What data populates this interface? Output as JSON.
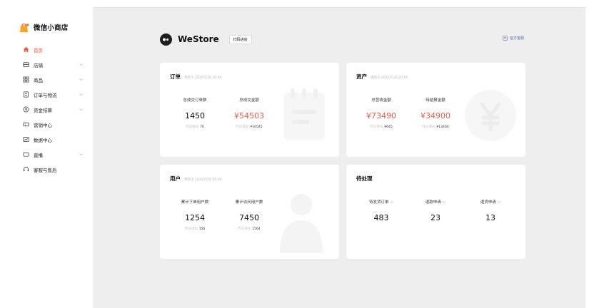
{
  "brand": {
    "name": "微信小商店"
  },
  "sidebar": {
    "items": [
      {
        "label": "首页",
        "icon": "home-icon",
        "active": true,
        "expandable": false
      },
      {
        "label": "店铺",
        "icon": "store-icon",
        "active": false,
        "expandable": true
      },
      {
        "label": "商品",
        "icon": "grid-icon",
        "active": false,
        "expandable": true
      },
      {
        "label": "订单与物流",
        "icon": "order-icon",
        "active": false,
        "expandable": true
      },
      {
        "label": "资金结算",
        "icon": "money-icon",
        "active": false,
        "expandable": true
      },
      {
        "label": "营销中心",
        "icon": "coupon-icon",
        "active": false,
        "expandable": false
      },
      {
        "label": "数据中心",
        "icon": "chart-icon",
        "active": false,
        "expandable": false
      },
      {
        "label": "直播",
        "icon": "live-icon",
        "active": false,
        "expandable": true
      },
      {
        "label": "客服与售后",
        "icon": "headset-icon",
        "active": false,
        "expandable": false
      }
    ]
  },
  "header": {
    "store_name": "WeStore",
    "scan_button": "扫码进店",
    "official_link": "官方客服"
  },
  "cards": {
    "orders": {
      "title": "订单",
      "updated": "更新于 2020/5/28 20:00",
      "stats": [
        {
          "label": "总成交订单数",
          "value": "1450",
          "sub_label": "昨日增加",
          "sub_value": "70"
        },
        {
          "label": "总成交金额",
          "value": "¥54503",
          "sub_label": "昨日增加",
          "sub_value": "¥10545"
        }
      ]
    },
    "assets": {
      "title": "资产",
      "updated": "更新于 2020/5/28 20:00",
      "stats": [
        {
          "label": "总营收金额",
          "value": "¥73490",
          "sub_label": "昨日增加",
          "sub_value": "¥645"
        },
        {
          "label": "待结算金额",
          "value": "¥34900",
          "sub_label": "昨日增加",
          "sub_value": "¥13400"
        }
      ]
    },
    "users": {
      "title": "用户",
      "updated": "更新于 2020/5/28 20:00",
      "stats": [
        {
          "label": "累计下单用户数",
          "value": "1254",
          "sub_label": "昨日增加",
          "sub_value": "156"
        },
        {
          "label": "累计访问用户数",
          "value": "7450",
          "sub_label": "昨日增加",
          "sub_value": "1564"
        }
      ]
    },
    "pending": {
      "title": "待处理",
      "stats": [
        {
          "label": "待发货订单",
          "value": "483"
        },
        {
          "label": "退款申请",
          "value": "23"
        },
        {
          "label": "退货申请",
          "value": "13"
        }
      ]
    }
  },
  "colors": {
    "accent": "#f25c3b",
    "link": "#5a73a8",
    "background": "#eeeeef"
  }
}
